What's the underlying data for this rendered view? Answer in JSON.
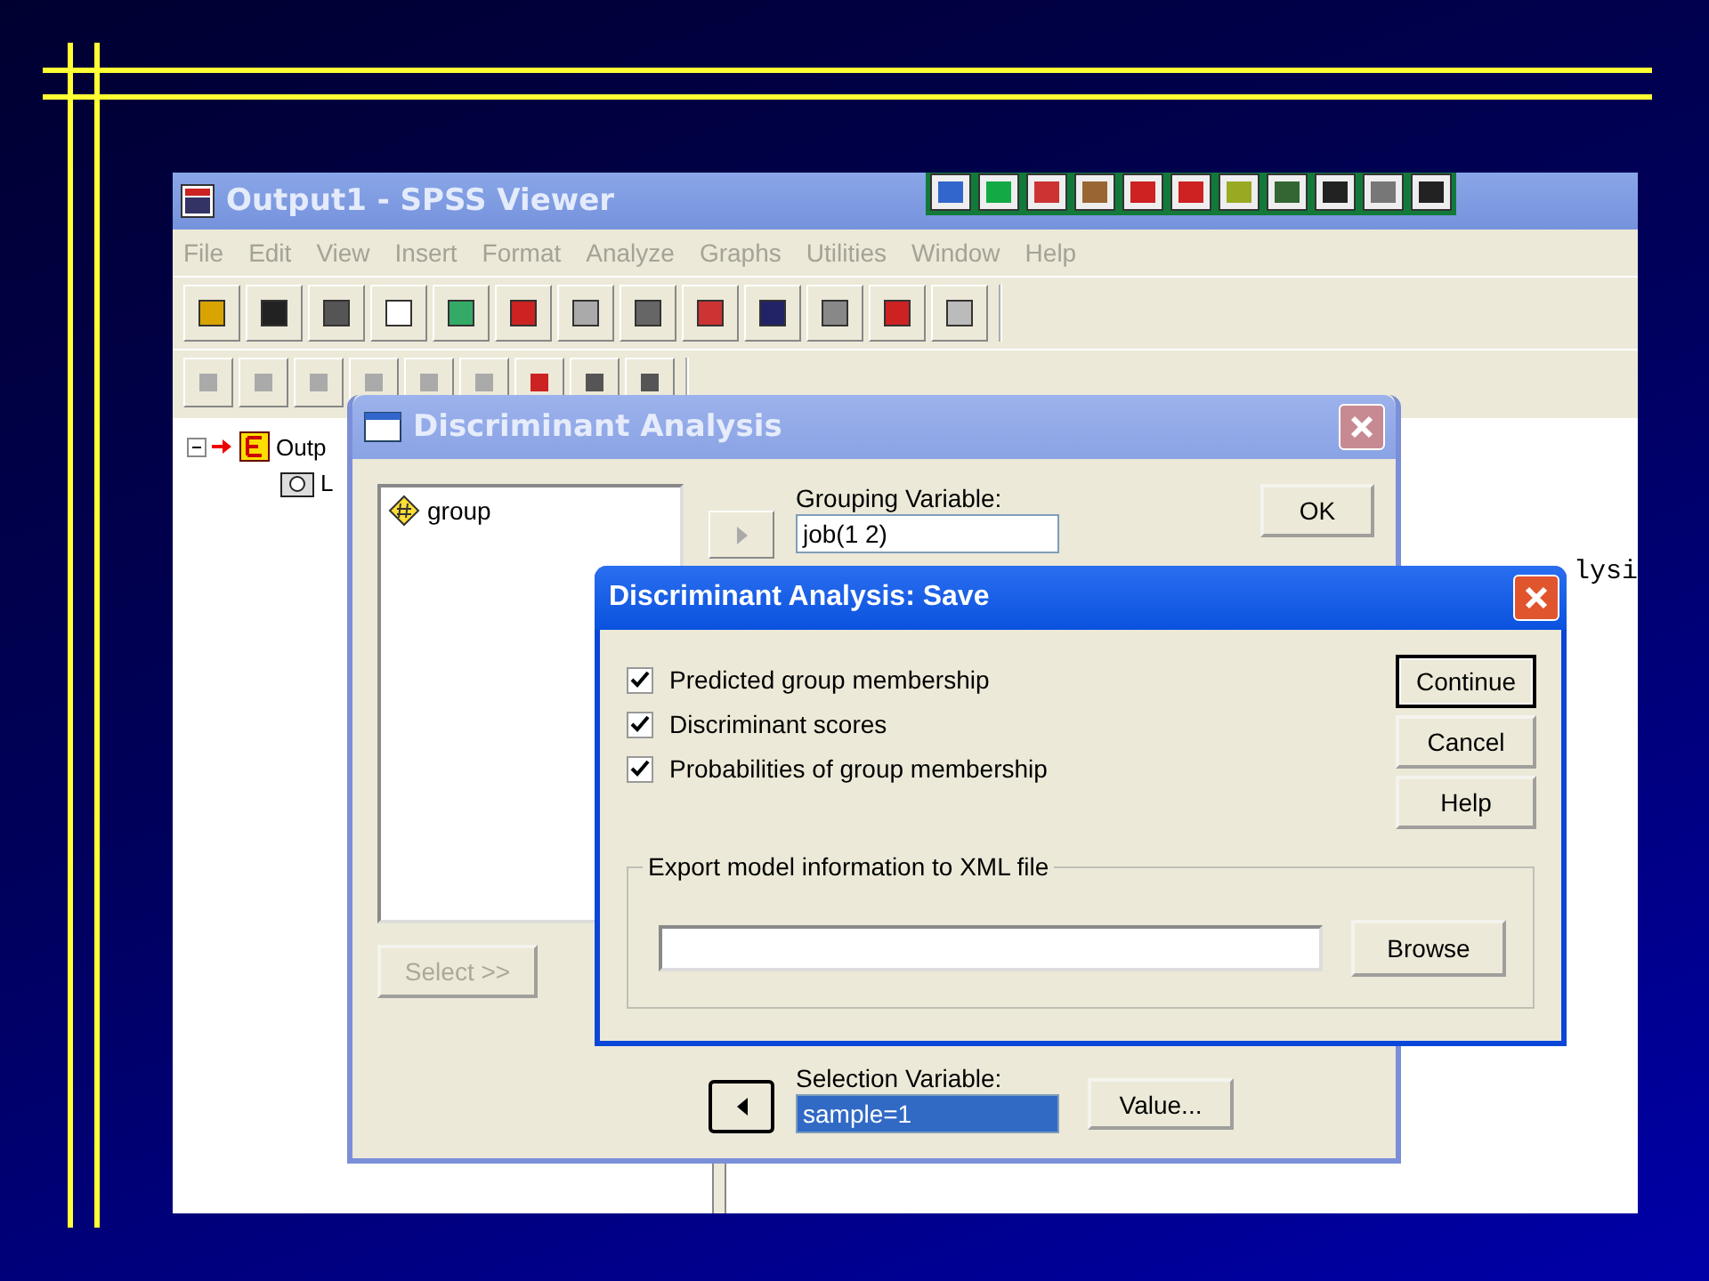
{
  "viewer": {
    "title": "Output1 - SPSS Viewer",
    "menu": [
      {
        "label": "File",
        "disabled": true
      },
      {
        "label": "Edit",
        "disabled": true
      },
      {
        "label": "View",
        "disabled": true
      },
      {
        "label": "Insert",
        "disabled": true
      },
      {
        "label": "Format",
        "disabled": true
      },
      {
        "label": "Analyze",
        "disabled": true
      },
      {
        "label": "Graphs",
        "disabled": true
      },
      {
        "label": "Utilities",
        "disabled": true
      },
      {
        "label": "Window",
        "disabled": true
      },
      {
        "label": "Help",
        "disabled": true
      }
    ],
    "tree": [
      {
        "label": "Outp",
        "expanded": true,
        "children": [
          {
            "label": "L"
          }
        ]
      }
    ],
    "output_text": "lysi"
  },
  "dialog": {
    "title": "Discriminant Analysis",
    "variables": [
      "group"
    ],
    "grouping_label": "Grouping Variable:",
    "grouping_value": "job(1 2)",
    "ok": "OK",
    "select_button": {
      "label": "Select >>",
      "disabled": true
    },
    "selection_label": "Selection Variable:",
    "selection_value": "sample=1",
    "value_button": "Value..."
  },
  "save_dialog": {
    "title": "Discriminant Analysis: Save",
    "options": [
      {
        "label": "Predicted group membership",
        "checked": true
      },
      {
        "label": "Discriminant scores",
        "checked": true
      },
      {
        "label": "Probabilities of group membership",
        "checked": true
      }
    ],
    "buttons": [
      {
        "label": "Continue",
        "default": true
      },
      {
        "label": "Cancel",
        "default": false
      },
      {
        "label": "Help",
        "default": false
      }
    ],
    "export_legend": "Export model information to XML file",
    "browse": "Browse"
  }
}
